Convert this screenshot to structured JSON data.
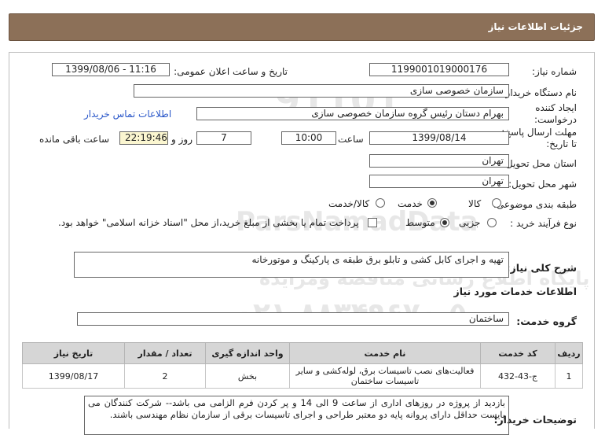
{
  "title": "جزئیات اطلاعات نیاز",
  "fields": {
    "need_number_label": "شماره نیاز:",
    "need_number": "1199001019000176",
    "announce_label": "تاریخ و ساعت اعلان عمومی:",
    "announce_value": "1399/08/06 - 11:16",
    "buyer_org_label": "نام دستگاه خریدار:",
    "buyer_org": "سازمان خصوصی سازی",
    "creator_label_1": "ایجاد کننده",
    "creator_label_2": "درخواست:",
    "creator": "بهرام دستان رئیس گروه سازمان خصوصی سازی",
    "buyer_contact_link": "اطلاعات تماس خریدار",
    "deadline_label_1": "مهلت ارسال پاسخ:",
    "deadline_label_2": "تا تاریخ:",
    "deadline_date": "1399/08/14",
    "time_label": "ساعت",
    "deadline_time": "10:00",
    "days_value": "7",
    "days_label": "روز و",
    "remaining_time": "22:19:46",
    "remaining_label": "ساعت باقی مانده",
    "province_label": "استان محل تحویل:",
    "province": "تهران",
    "city_label": "شهر محل تحویل:",
    "city": "تهران",
    "category_label": "طبقه بندی موضوعی:",
    "category_options": [
      "کالا",
      "خدمت",
      "کالا/خدمت"
    ],
    "category_selected": "خدمت",
    "process_label": "نوع فرآیند خرید :",
    "process_options": [
      "جزیی",
      "متوسط"
    ],
    "process_selected": "متوسط",
    "payment_note": "پرداخت تمام یا بخشی از مبلغ خرید،از محل \"اسناد خزانه اسلامی\" خواهد بود."
  },
  "summary": {
    "label": "شرح کلی نیاز:",
    "text": "تهیه و اجرای کابل کشی و تابلو برق طبقه ی پارکینگ و موتورخانه"
  },
  "services_section": {
    "heading": "اطلاعات خدمات مورد نیاز",
    "group_label": "گروه خدمت:",
    "group_value": "ساختمان"
  },
  "table": {
    "headers": [
      "ردیف",
      "کد خدمت",
      "نام خدمت",
      "واحد اندازه گیری",
      "تعداد / مقدار",
      "تاریخ نیاز"
    ],
    "rows": [
      {
        "row": "1",
        "code": "ج-43-432",
        "name": "فعالیت‌های نصب تاسیسات برق، لوله‌کشی و سایر تاسیسات ساختمان",
        "unit": "بخش",
        "qty": "2",
        "date": "1399/08/17"
      }
    ]
  },
  "buyer_notes": {
    "label": "توضیحات خریدار:",
    "text": "بازدید از پروژه در روزهای اداری از ساعت 9 الی 14 و پر کردن فرم الزامی می باشد-- شرکت کنندگان می بایست حداقل دارای پروانه پایه دو معتبر طراحی و اجرای تاسیسات برقی از سازمان نظام مهندسی باشند."
  },
  "watermark": {
    "brand": "ParsNamadData",
    "line1": "پایگاه اطلاع رسانی مناقصه ومزایده",
    "phone": "۰۲۱-۸۸۳۴۹۶۷۰-۵",
    "number": "91101"
  }
}
